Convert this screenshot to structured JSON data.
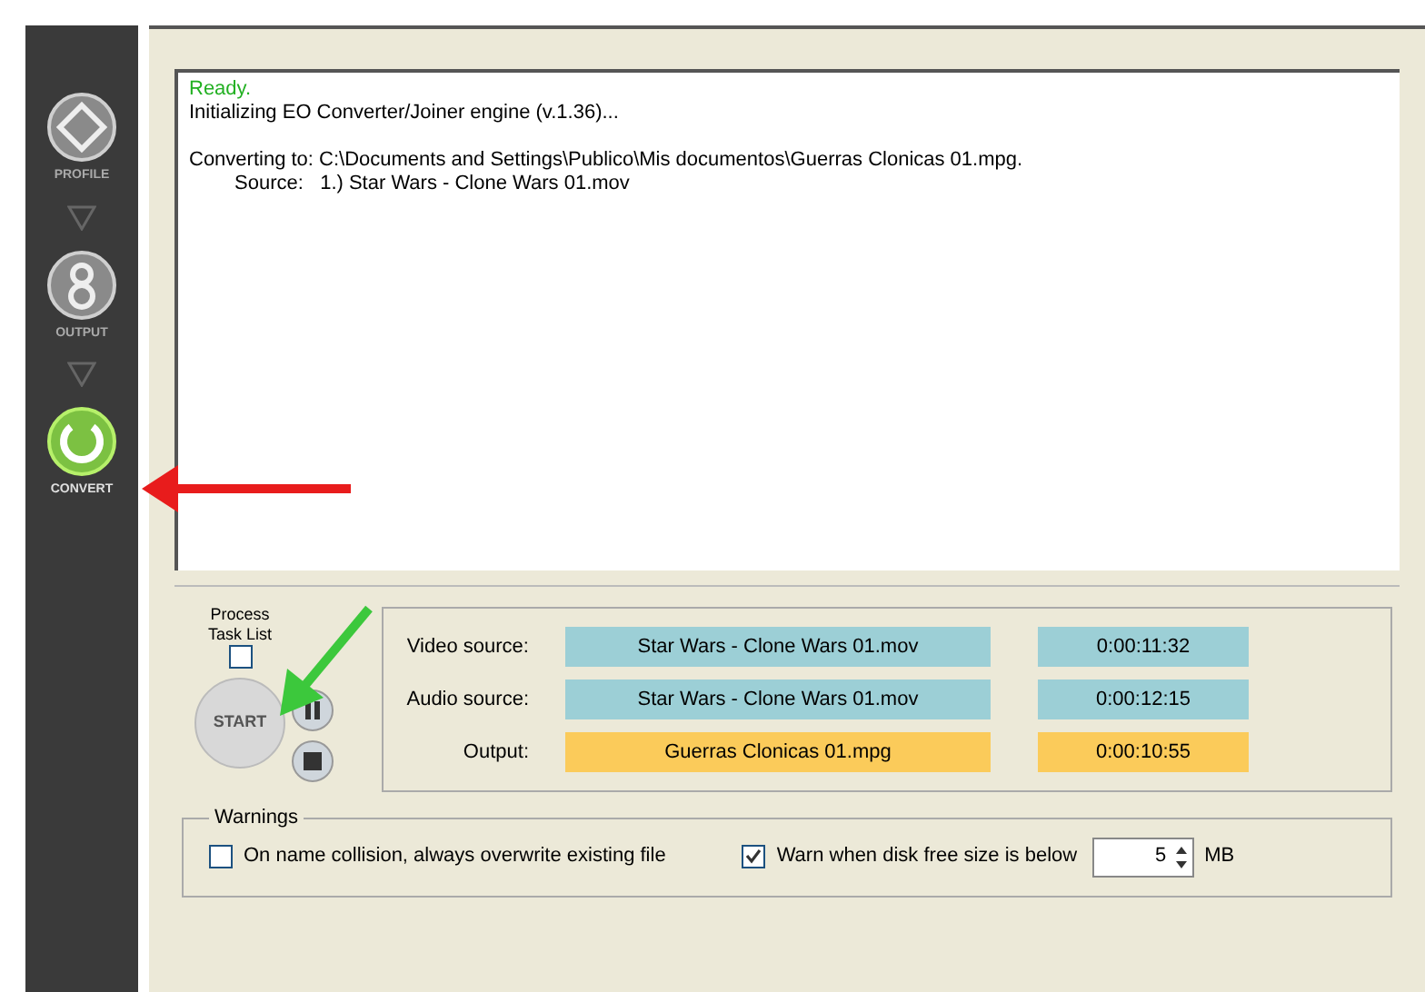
{
  "sidebar": {
    "items": [
      {
        "label": "PROFILE",
        "kind": "profile",
        "selected": false
      },
      {
        "label": "OUTPUT",
        "kind": "output",
        "selected": false
      },
      {
        "label": "CONVERT",
        "kind": "convert",
        "selected": true
      }
    ]
  },
  "log": {
    "lines": [
      {
        "text": "Ready.",
        "kind": "status",
        "spaced": false
      },
      {
        "text": "Initializing EO Converter/Joiner engine (v.1.36)...",
        "kind": "info",
        "spaced": false
      },
      {
        "text": "Converting to: C:\\Documents and Settings\\Publico\\Mis documentos\\Guerras Clonicas 01.mpg.",
        "kind": "info",
        "spaced": true
      },
      {
        "text": "Source:   1.) Star Wars - Clone Wars 01.mov",
        "kind": "detail",
        "spaced": false
      }
    ]
  },
  "controls": {
    "process_task_list": {
      "label": "Process Task List",
      "checked": false
    },
    "start_label": "START"
  },
  "files": [
    {
      "label": "Video source:",
      "value": "Star Wars - Clone Wars 01.mov",
      "time": "0:00:11:32",
      "kind": "source"
    },
    {
      "label": "Audio source:",
      "value": "Star Wars - Clone Wars 01.mov",
      "time": "0:00:12:15",
      "kind": "source"
    },
    {
      "label": "Output:",
      "value": "Guerras Clonicas 01.mpg",
      "time": "0:00:10:55",
      "kind": "output"
    }
  ],
  "warnings": {
    "title": "Warnings",
    "overwrite": {
      "label": "On name collision, always overwrite existing file",
      "checked": false
    },
    "disk": {
      "label": "Warn when disk free size is below",
      "checked": true,
      "value": "5",
      "unit": "MB"
    }
  }
}
